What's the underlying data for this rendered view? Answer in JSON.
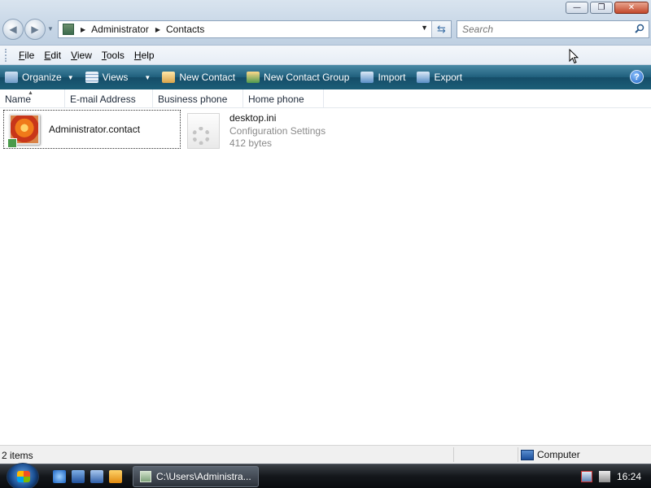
{
  "window": {
    "controls": {
      "minimize": "—",
      "maximize": "❐",
      "close": "✕"
    }
  },
  "nav": {
    "back_icon": "back-arrow-icon",
    "forward_icon": "forward-arrow-icon"
  },
  "address": {
    "crumbs": [
      "Administrator",
      "Contacts"
    ]
  },
  "search": {
    "placeholder": "Search"
  },
  "menu": [
    {
      "underline": "F",
      "rest": "ile"
    },
    {
      "underline": "E",
      "rest": "dit"
    },
    {
      "underline": "V",
      "rest": "iew"
    },
    {
      "underline": "T",
      "rest": "ools"
    },
    {
      "underline": "H",
      "rest": "elp"
    }
  ],
  "commands": {
    "organize": "Organize",
    "views": "Views",
    "new_contact": "New Contact",
    "new_contact_group": "New Contact Group",
    "import": "Import",
    "export": "Export",
    "help": "?"
  },
  "columns": [
    "Name",
    "E-mail Address",
    "Business phone",
    "Home phone"
  ],
  "items": {
    "contact": {
      "name": "Administrator.contact"
    },
    "ini": {
      "name": "desktop.ini",
      "type": "Configuration Settings",
      "size": "412 bytes"
    }
  },
  "status": {
    "count": "2 items",
    "zone": "Computer"
  },
  "taskbar": {
    "task_label": "C:\\Users\\Administra...",
    "clock": "16:24"
  },
  "colors": {
    "command_bar": "#1f5f7c",
    "accent": "#3a6ea5"
  }
}
